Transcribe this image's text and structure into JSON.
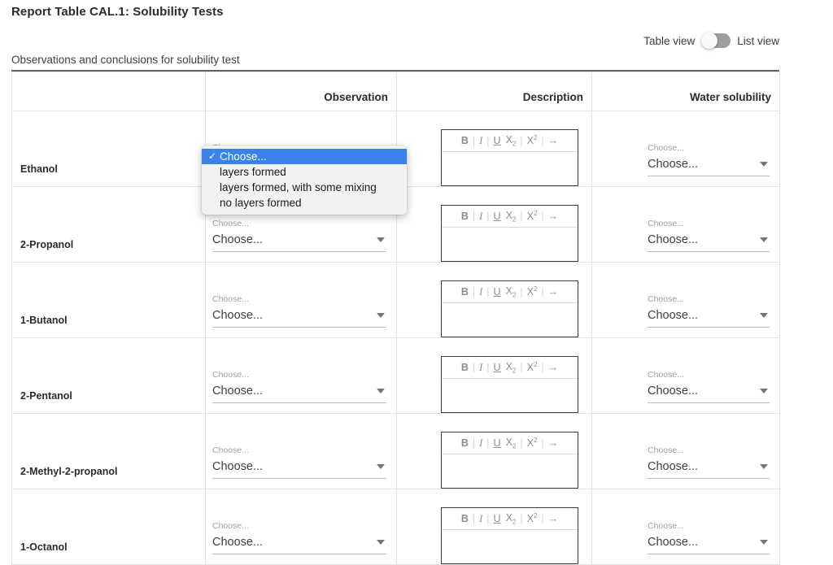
{
  "page": {
    "title": "Report Table CAL.1: Solubility Tests"
  },
  "view_toggle": {
    "left_label": "Table view",
    "right_label": "List view",
    "state": "table",
    "track_color": "#9e9e9e",
    "knob_color": "#fafafa"
  },
  "table": {
    "caption": "Observations and conclusions for solubility test",
    "headers": [
      "",
      "Observation",
      "Description",
      "Water solubility"
    ],
    "rows": [
      {
        "name": "Ethanol",
        "observation": {
          "label": "Choose...",
          "value": "Choose..."
        },
        "description": "",
        "water_solubility": {
          "label": "Choose...",
          "value": "Choose..."
        }
      },
      {
        "name": "2-Propanol",
        "observation": {
          "label": "Choose...",
          "value": "Choose..."
        },
        "description": "",
        "water_solubility": {
          "label": "Choose...",
          "value": "Choose..."
        }
      },
      {
        "name": "1-Butanol",
        "observation": {
          "label": "Choose...",
          "value": "Choose..."
        },
        "description": "",
        "water_solubility": {
          "label": "Choose...",
          "value": "Choose..."
        }
      },
      {
        "name": "2-Pentanol",
        "observation": {
          "label": "Choose...",
          "value": "Choose..."
        },
        "description": "",
        "water_solubility": {
          "label": "Choose...",
          "value": "Choose..."
        }
      },
      {
        "name": "2-Methyl-2-propanol",
        "observation": {
          "label": "Choose...",
          "value": "Choose..."
        },
        "description": "",
        "water_solubility": {
          "label": "Choose...",
          "value": "Choose..."
        }
      },
      {
        "name": "1-Octanol",
        "observation": {
          "label": "Choose...",
          "value": "Choose..."
        },
        "description": "",
        "water_solubility": {
          "label": "Choose...",
          "value": "Choose..."
        }
      }
    ]
  },
  "editor_toolbar": {
    "bold": "B",
    "italic": "I",
    "underline": "U",
    "subscript": "X",
    "subscript_index": "2",
    "superscript": "X",
    "superscript_index": "2",
    "more": "→",
    "separator": "|"
  },
  "open_dropdown": {
    "owner_row": "Ethanol",
    "owner_column": "Observation",
    "selected_index": 0,
    "highlight_color": "#3b82e8",
    "check_glyph": "✓",
    "options": [
      "Choose...",
      "layers formed",
      "layers formed, with some mixing",
      "no layers formed"
    ]
  }
}
